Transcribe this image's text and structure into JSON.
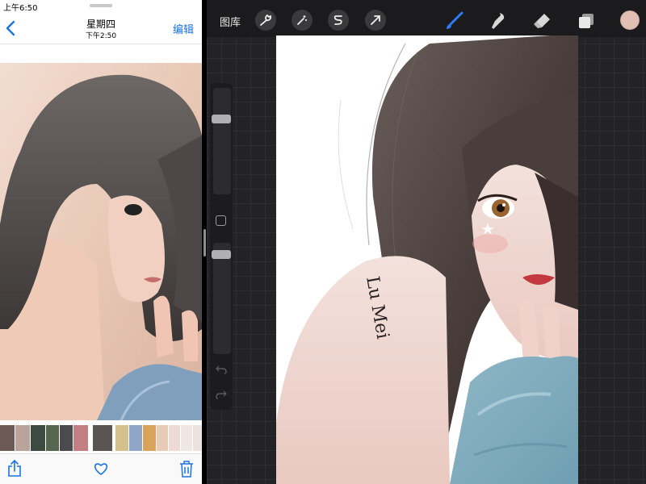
{
  "status_bar": {
    "time": "上午6:50"
  },
  "photos_app": {
    "nav": {
      "title": "星期四",
      "subtitle": "下午2:50",
      "edit_label": "编辑"
    },
    "filmstrip_thumbnails": 15,
    "tab_icons": [
      "share-icon",
      "heart-icon",
      "trash-icon"
    ]
  },
  "procreate": {
    "gallery_label": "图库",
    "action_tools": [
      "wrench-icon",
      "magic-wand-icon",
      "selection-icon",
      "transform-arrow-icon"
    ],
    "paint_tools": [
      "brush-icon",
      "smudge-icon",
      "eraser-icon",
      "layers-icon"
    ],
    "active_tool": "brush-icon",
    "current_color": "#e2bfb3",
    "brush_size_level": 0.27,
    "opacity_level": 0.07,
    "canvas_text": "Lu Mei"
  },
  "colors": {
    "accent_blue": "#1a73e8",
    "brush_active": "#2f7bf5"
  }
}
